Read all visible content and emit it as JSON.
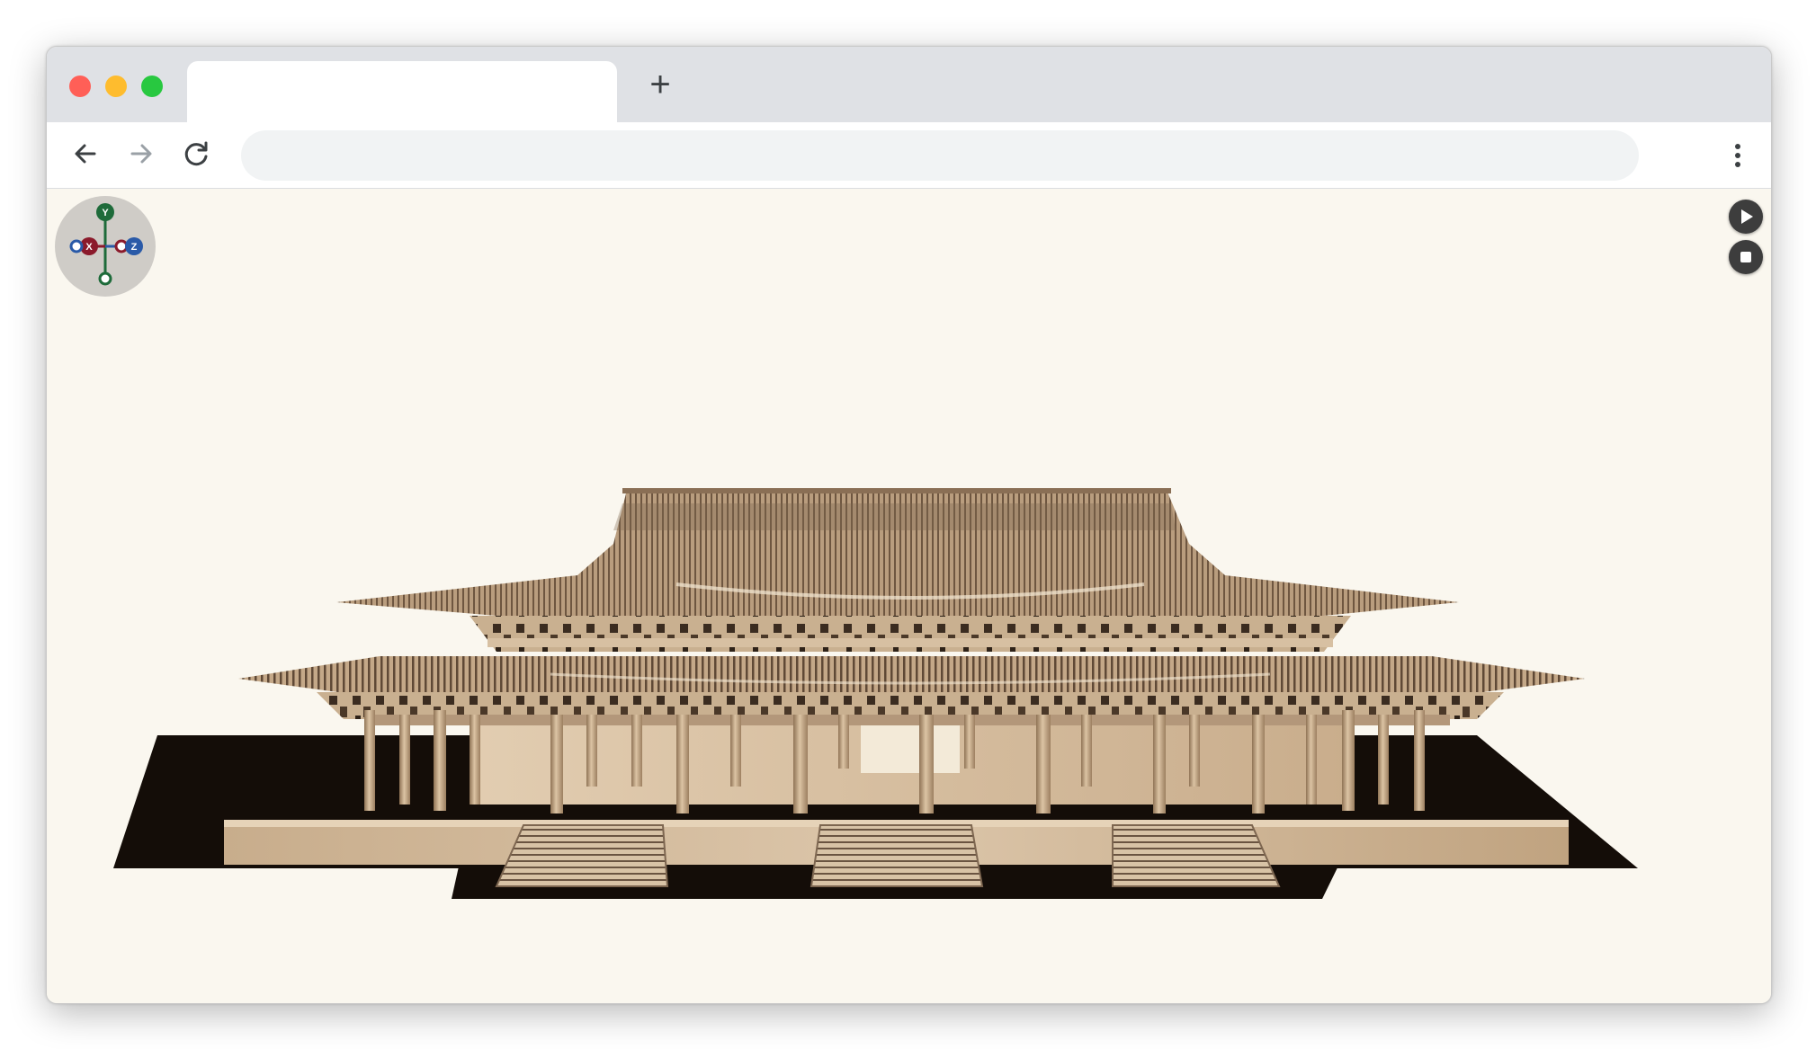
{
  "browser": {
    "tab_title": "",
    "new_tab_icon": "plus-icon",
    "address": "",
    "nav_icons": [
      "arrow-left-icon",
      "arrow-right-icon",
      "reload-icon",
      "more-vertical-icon"
    ]
  },
  "viewer": {
    "axes": {
      "y": "Y",
      "x": "X",
      "z": "Z"
    },
    "controls": [
      "play-icon",
      "stop-icon"
    ],
    "model_colors": {
      "wood": "#b89e7f",
      "wood_light": "#d9c3a6",
      "shadow": "#140d08",
      "background": "#faf7ef"
    },
    "axis_colors": {
      "y": "#1e6b3a",
      "x": "#8b1a2b",
      "z": "#2a5aa8"
    }
  }
}
